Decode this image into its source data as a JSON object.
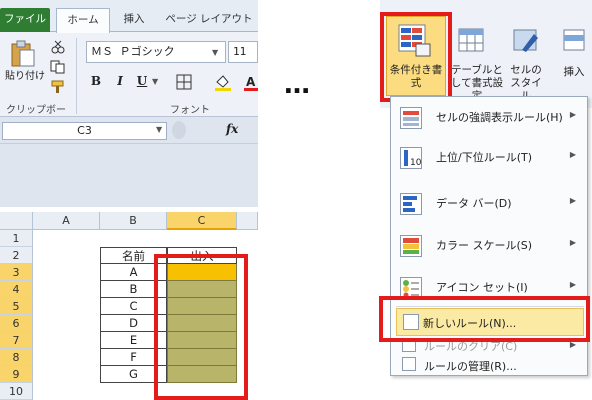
{
  "left_ribbon": {
    "tabs": [
      {
        "label": "ファイル"
      },
      {
        "label": "ホーム"
      },
      {
        "label": "挿入"
      },
      {
        "label": "ページ レイアウト"
      }
    ],
    "paste_label": "貼り付け",
    "font_name": "ＭＳ Ｐゴシック",
    "font_size": "11",
    "bold": "B",
    "italic": "I",
    "underline": "U",
    "clipboard_group": "クリップボード",
    "font_group": "フォント"
  },
  "formula_bar": {
    "name_box": "C3",
    "fx": "fx"
  },
  "sheet": {
    "columns": [
      "A",
      "B",
      "C"
    ],
    "rows": [
      "1",
      "2",
      "3",
      "4",
      "5",
      "6",
      "7",
      "8",
      "9",
      "10"
    ],
    "header_name": "名前",
    "header_entry": "出入",
    "names": [
      "A",
      "B",
      "C",
      "D",
      "E",
      "F",
      "G"
    ]
  },
  "ellipsis": "…",
  "right_ribbon": {
    "conditional_format": "条件付き書式",
    "format_as_table": "テーブルとして書式設定",
    "cell_styles": "セルのスタイル",
    "insert": "挿入"
  },
  "cf_menu": {
    "items": [
      {
        "label": "セルの強調表示ルール(H)"
      },
      {
        "label": "上位/下位ルール(T)"
      },
      {
        "label": "データ バー(D)"
      },
      {
        "label": "カラー スケール(S)"
      },
      {
        "label": "アイコン セット(I)"
      },
      {
        "label": "新しいルール(N)..."
      },
      {
        "label": "ルールのクリア(C)"
      },
      {
        "label": "ルールの管理(R)..."
      }
    ]
  },
  "colors": {
    "highlight_red": "#e31b1b",
    "selected_cell": "#f7c000",
    "range_fill": "#b8b46a"
  }
}
